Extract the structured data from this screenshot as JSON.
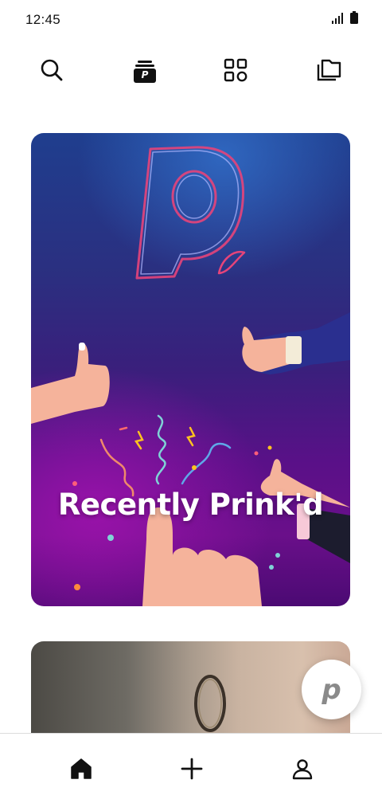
{
  "status_bar": {
    "time": "12:45",
    "icons": [
      "signal-icon",
      "battery-icon"
    ]
  },
  "top_nav": {
    "items": [
      {
        "icon": "search-icon"
      },
      {
        "icon": "prink-stack-icon",
        "badge_letter": "P"
      },
      {
        "icon": "categories-grid-icon"
      },
      {
        "icon": "collections-icon"
      }
    ]
  },
  "feed": {
    "featured_card": {
      "title": "Recently Prink'd"
    }
  },
  "fab": {
    "icon": "prink-logo-icon",
    "logo_letter": "p"
  },
  "bottom_nav": {
    "items": [
      {
        "icon": "home-icon"
      },
      {
        "icon": "add-icon"
      },
      {
        "icon": "profile-icon"
      }
    ]
  },
  "colors": {
    "accent": "#111111",
    "background": "#ffffff",
    "card_top": "#1f3e8e",
    "card_bottom": "#6a0f8a"
  }
}
